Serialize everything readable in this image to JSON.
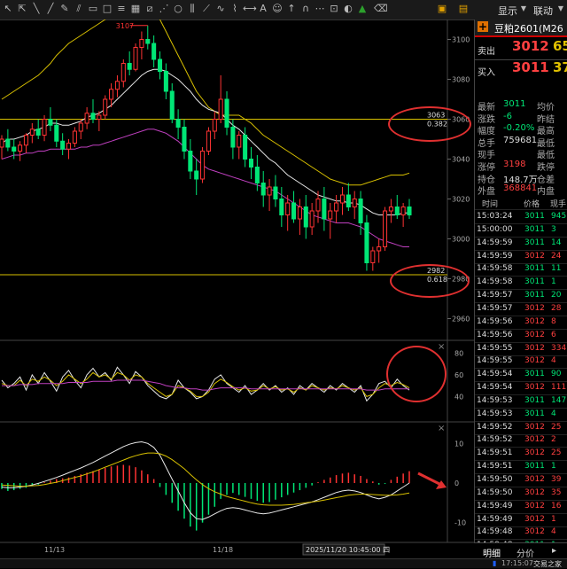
{
  "toolbar": {
    "display_label": "显示",
    "linkage_label": "联动"
  },
  "colors": {
    "up": "#ff3333",
    "down": "#00e676",
    "ma_yellow": "#d8c000",
    "ma_white": "#e8e8e8",
    "ma_purple": "#c040c0",
    "accent": "#e03030"
  },
  "quote": {
    "title": "豆粕2601(M26",
    "sell_label": "卖出",
    "sell_price": "3012",
    "sell_vol": "65",
    "buy_label": "买入",
    "buy_price": "3011",
    "buy_vol": "37",
    "stats": [
      {
        "label": "最新",
        "value": "3011",
        "label2": "均价",
        "value2": ""
      },
      {
        "label": "涨跌",
        "value": "-6",
        "label2": "昨结",
        "value2": ""
      },
      {
        "label": "幅度",
        "value": "-0.20%",
        "label2": "最高",
        "value2": ""
      },
      {
        "label": "总手",
        "value": "759681",
        "label2": "最低",
        "value2": ""
      },
      {
        "label": "现手",
        "value": "",
        "label2": "最低",
        "value2": ""
      },
      {
        "label": "涨停",
        "value": "3198",
        "label2": "跌停",
        "value2": ""
      },
      {
        "label": "持仓",
        "value": "148.7万",
        "label2": "仓差",
        "value2": ""
      },
      {
        "label": "外盘",
        "value": "368841",
        "label2": "内盘",
        "value2": ""
      }
    ],
    "ticks_header": {
      "time": "时间",
      "price": "价格",
      "vol": "现手"
    },
    "ticks": [
      {
        "time": "15:03:24",
        "price": "3011",
        "vol": "945",
        "dir": "down"
      },
      {
        "time": "15:00:00",
        "price": "3011",
        "vol": "3",
        "dir": "down"
      },
      {
        "time": "14:59:59",
        "price": "3011",
        "vol": "14",
        "dir": "down"
      },
      {
        "time": "14:59:59",
        "price": "3012",
        "vol": "24",
        "dir": "up"
      },
      {
        "time": "14:59:58",
        "price": "3011",
        "vol": "11",
        "dir": "down"
      },
      {
        "time": "14:59:58",
        "price": "3011",
        "vol": "1",
        "dir": "down"
      },
      {
        "time": "14:59:57",
        "price": "3011",
        "vol": "20",
        "dir": "down"
      },
      {
        "time": "14:59:57",
        "price": "3012",
        "vol": "28",
        "dir": "up"
      },
      {
        "time": "14:59:56",
        "price": "3012",
        "vol": "8",
        "dir": "up"
      },
      {
        "time": "14:59:56",
        "price": "3012",
        "vol": "6",
        "dir": "up"
      },
      {
        "time": "14:59:55",
        "price": "3012",
        "vol": "334",
        "dir": "up"
      },
      {
        "time": "14:59:55",
        "price": "3012",
        "vol": "4",
        "dir": "up"
      },
      {
        "time": "14:59:54",
        "price": "3011",
        "vol": "90",
        "dir": "down"
      },
      {
        "time": "14:59:54",
        "price": "3012",
        "vol": "111",
        "dir": "up"
      },
      {
        "time": "14:59:53",
        "price": "3011",
        "vol": "147",
        "dir": "down"
      },
      {
        "time": "14:59:53",
        "price": "3011",
        "vol": "4",
        "dir": "down"
      },
      {
        "time": "14:59:52",
        "price": "3012",
        "vol": "25",
        "dir": "up"
      },
      {
        "time": "14:59:52",
        "price": "3012",
        "vol": "2",
        "dir": "up"
      },
      {
        "time": "14:59:51",
        "price": "3012",
        "vol": "25",
        "dir": "up"
      },
      {
        "time": "14:59:51",
        "price": "3011",
        "vol": "1",
        "dir": "down"
      },
      {
        "time": "14:59:50",
        "price": "3012",
        "vol": "39",
        "dir": "up"
      },
      {
        "time": "14:59:50",
        "price": "3012",
        "vol": "35",
        "dir": "up"
      },
      {
        "time": "14:59:49",
        "price": "3012",
        "vol": "16",
        "dir": "up"
      },
      {
        "time": "14:59:49",
        "price": "3012",
        "vol": "1",
        "dir": "up"
      },
      {
        "time": "14:59:48",
        "price": "3012",
        "vol": "4",
        "dir": "up"
      },
      {
        "time": "14:59:48",
        "price": "3011",
        "vol": "1",
        "dir": "down"
      }
    ]
  },
  "bottom_tabs": {
    "detail": "明细",
    "price_split": "分价"
  },
  "statusbar": {
    "clock": "17:15:07",
    "brand": "交易之家"
  },
  "chart_data": {
    "type": "candlestick",
    "price_axis": {
      "ylim": [
        2950,
        3110
      ],
      "ticks": [
        "3100",
        "3080",
        "3060",
        "3040",
        "3020",
        "3000",
        "2980",
        "2960"
      ]
    },
    "high_marker": "3107",
    "fib_levels": [
      {
        "price": "3063",
        "ratio": "0.382",
        "y": 3060
      },
      {
        "price": "2982",
        "ratio": "0.618",
        "y": 2982
      }
    ],
    "x_labels": [
      "11/13",
      "11/18"
    ],
    "cursor_label": "2025/11/20 10:45:00 四",
    "candles": [
      [
        3046,
        3052,
        3040,
        3050
      ],
      [
        3050,
        3055,
        3044,
        3046
      ],
      [
        3046,
        3050,
        3040,
        3044
      ],
      [
        3044,
        3049,
        3039,
        3047
      ],
      [
        3047,
        3053,
        3043,
        3052
      ],
      [
        3052,
        3058,
        3048,
        3055
      ],
      [
        3055,
        3060,
        3050,
        3052
      ],
      [
        3052,
        3062,
        3049,
        3060
      ],
      [
        3060,
        3066,
        3054,
        3057
      ],
      [
        3057,
        3060,
        3046,
        3049
      ],
      [
        3049,
        3053,
        3042,
        3045
      ],
      [
        3045,
        3050,
        3040,
        3048
      ],
      [
        3048,
        3056,
        3046,
        3054
      ],
      [
        3054,
        3060,
        3050,
        3058
      ],
      [
        3058,
        3066,
        3055,
        3063
      ],
      [
        3063,
        3070,
        3058,
        3060
      ],
      [
        3060,
        3064,
        3054,
        3062
      ],
      [
        3062,
        3072,
        3060,
        3070
      ],
      [
        3070,
        3078,
        3066,
        3075
      ],
      [
        3075,
        3082,
        3071,
        3079
      ],
      [
        3079,
        3090,
        3076,
        3088
      ],
      [
        3088,
        3094,
        3082,
        3085
      ],
      [
        3085,
        3098,
        3084,
        3096
      ],
      [
        3096,
        3104,
        3090,
        3100
      ],
      [
        3100,
        3107,
        3095,
        3098
      ],
      [
        3098,
        3102,
        3086,
        3090
      ],
      [
        3090,
        3094,
        3080,
        3084
      ],
      [
        3084,
        3088,
        3070,
        3074
      ],
      [
        3074,
        3078,
        3058,
        3060
      ],
      [
        3060,
        3065,
        3050,
        3056
      ],
      [
        3056,
        3060,
        3040,
        3044
      ],
      [
        3044,
        3050,
        3030,
        3034
      ],
      [
        3034,
        3040,
        3022,
        3030
      ],
      [
        3030,
        3046,
        3028,
        3044
      ],
      [
        3044,
        3056,
        3042,
        3054
      ],
      [
        3054,
        3064,
        3050,
        3060
      ],
      [
        3060,
        3082,
        3058,
        3070
      ],
      [
        3070,
        3074,
        3052,
        3056
      ],
      [
        3056,
        3060,
        3040,
        3046
      ],
      [
        3046,
        3054,
        3040,
        3052
      ],
      [
        3052,
        3056,
        3036,
        3040
      ],
      [
        3040,
        3046,
        3030,
        3036
      ],
      [
        3036,
        3042,
        3024,
        3028
      ],
      [
        3028,
        3034,
        3016,
        3022
      ],
      [
        3022,
        3030,
        3014,
        3026
      ],
      [
        3026,
        3032,
        3016,
        3020
      ],
      [
        3020,
        3026,
        3006,
        3012
      ],
      [
        3012,
        3022,
        3004,
        3018
      ],
      [
        3018,
        3024,
        3008,
        3010
      ],
      [
        3010,
        3020,
        3002,
        3016
      ],
      [
        3016,
        3022,
        3000,
        3006
      ],
      [
        3006,
        3018,
        3002,
        3014
      ],
      [
        3014,
        3024,
        3008,
        3020
      ],
      [
        3020,
        3026,
        3004,
        3010
      ],
      [
        3010,
        3018,
        3000,
        3014
      ],
      [
        3014,
        3022,
        3008,
        3018
      ],
      [
        3018,
        3026,
        3012,
        3022
      ],
      [
        3022,
        3028,
        3014,
        3016
      ],
      [
        3016,
        3024,
        3010,
        3020
      ],
      [
        3020,
        3024,
        3002,
        3008
      ],
      [
        3008,
        3012,
        2984,
        2988
      ],
      [
        2988,
        2996,
        2984,
        2994
      ],
      [
        2994,
        3000,
        2988,
        2996
      ],
      [
        2996,
        3016,
        2994,
        3014
      ],
      [
        3014,
        3020,
        3008,
        3016
      ],
      [
        3016,
        3022,
        3010,
        3012
      ],
      [
        3012,
        3018,
        3006,
        3016
      ],
      [
        3016,
        3020,
        3010,
        3012
      ]
    ],
    "ma_white": [
      3048,
      3050,
      3050,
      3051,
      3052,
      3054,
      3055,
      3056,
      3058,
      3058,
      3057,
      3057,
      3058,
      3059,
      3061,
      3062,
      3063,
      3065,
      3067,
      3070,
      3073,
      3076,
      3079,
      3082,
      3084,
      3085,
      3085,
      3084,
      3082,
      3080,
      3077,
      3074,
      3070,
      3067,
      3065,
      3064,
      3063,
      3060,
      3057,
      3055,
      3052,
      3049,
      3046,
      3043,
      3040,
      3038,
      3035,
      3032,
      3030,
      3028,
      3026,
      3024,
      3022,
      3021,
      3020,
      3019,
      3019,
      3018,
      3018,
      3017,
      3015,
      3013,
      3012,
      3012,
      3012,
      3012,
      3013,
      3013
    ],
    "ma_purple": [
      3040,
      3041,
      3042,
      3042,
      3043,
      3043,
      3044,
      3044,
      3045,
      3045,
      3045,
      3045,
      3045,
      3046,
      3046,
      3047,
      3047,
      3048,
      3049,
      3050,
      3051,
      3052,
      3053,
      3054,
      3055,
      3055,
      3054,
      3053,
      3051,
      3049,
      3046,
      3043,
      3040,
      3037,
      3035,
      3034,
      3033,
      3032,
      3031,
      3030,
      3029,
      3028,
      3027,
      3026,
      3025,
      3024,
      3022,
      3020,
      3018,
      3016,
      3014,
      3012,
      3011,
      3010,
      3009,
      3008,
      3008,
      3008,
      3007,
      3006,
      3004,
      3002,
      3000,
      2999,
      2998,
      2997,
      2996,
      2996
    ],
    "boll_upper": [
      3070,
      3072,
      3074,
      3076,
      3078,
      3080,
      3082,
      3085,
      3088,
      3092,
      3095,
      3098,
      3100,
      3102,
      3104,
      3106,
      3108,
      3110,
      3112,
      3114,
      3116,
      3118,
      3120,
      3120,
      3118,
      3115,
      3110,
      3104,
      3098,
      3092,
      3086,
      3080,
      3074,
      3070,
      3066,
      3064,
      3062,
      3062,
      3062,
      3062,
      3060,
      3058,
      3055,
      3052,
      3050,
      3048,
      3046,
      3044,
      3042,
      3040,
      3038,
      3036,
      3034,
      3032,
      3030,
      3029,
      3028,
      3027,
      3027,
      3027,
      3028,
      3029,
      3030,
      3031,
      3032,
      3032,
      3032,
      3033
    ],
    "rsi": {
      "ticks": [
        "80",
        "60",
        "40"
      ],
      "ylim": [
        20,
        90
      ],
      "white": [
        55,
        48,
        52,
        58,
        46,
        60,
        52,
        62,
        54,
        45,
        58,
        64,
        55,
        48,
        60,
        66,
        58,
        62,
        55,
        67,
        60,
        52,
        63,
        58,
        50,
        45,
        40,
        38,
        42,
        55,
        48,
        44,
        38,
        40,
        46,
        56,
        60,
        52,
        48,
        44,
        50,
        42,
        46,
        52,
        46,
        50,
        44,
        48,
        42,
        50,
        46,
        52,
        48,
        44,
        50,
        46,
        52,
        48,
        44,
        50,
        36,
        42,
        52,
        54,
        48,
        56,
        50,
        46
      ],
      "yellow": [
        52,
        50,
        50,
        55,
        50,
        56,
        54,
        58,
        55,
        50,
        54,
        60,
        56,
        52,
        56,
        62,
        58,
        60,
        56,
        62,
        60,
        55,
        60,
        58,
        52,
        48,
        44,
        40,
        42,
        50,
        48,
        45,
        40,
        40,
        44,
        52,
        56,
        53,
        49,
        46,
        48,
        45,
        46,
        50,
        47,
        49,
        46,
        47,
        44,
        48,
        46,
        50,
        48,
        46,
        48,
        47,
        50,
        48,
        46,
        48,
        40,
        42,
        48,
        52,
        50,
        53,
        51,
        48
      ],
      "purple": [
        50,
        50,
        50,
        51,
        51,
        51,
        52,
        52,
        52,
        52,
        52,
        53,
        53,
        53,
        53,
        54,
        54,
        54,
        54,
        55,
        55,
        55,
        55,
        55,
        54,
        53,
        52,
        50,
        49,
        48,
        48,
        47,
        47,
        46,
        46,
        47,
        48,
        48,
        48,
        48,
        48,
        47,
        47,
        47,
        47,
        47,
        47,
        47,
        47,
        47,
        47,
        47,
        47,
        47,
        47,
        47,
        47,
        47,
        47,
        47,
        46,
        46,
        46,
        47,
        47,
        47,
        47,
        47
      ]
    },
    "macd": {
      "ticks": [
        "10",
        "0",
        "-10"
      ],
      "ylim": [
        -15,
        15
      ],
      "hist": [
        -1.5,
        -2,
        -1.8,
        -1.5,
        -1.2,
        -0.8,
        -0.4,
        0.2,
        0.6,
        1,
        1.2,
        1.4,
        1.8,
        2.2,
        2.6,
        3,
        3.4,
        3.8,
        4.2,
        4.4,
        4.6,
        4.4,
        4,
        3.2,
        2.2,
        1,
        -1,
        -3,
        -5,
        -7,
        -9,
        -11,
        -12,
        -10,
        -8,
        -6,
        -4,
        -3,
        -2.5,
        -3,
        -3.5,
        -4,
        -4.5,
        -5,
        -4.8,
        -4.2,
        -3.6,
        -3,
        -2.4,
        -1.8,
        -1.2,
        -0.6,
        0.2,
        0.8,
        1.4,
        2,
        2.4,
        2.6,
        2.2,
        1.8,
        1,
        0.4,
        -0.4,
        -0.2,
        0.8,
        1.6,
        2.4,
        3
      ],
      "dif": [
        -1,
        -1.2,
        -1.2,
        -1,
        -0.8,
        -0.5,
        -0.1,
        0.4,
        0.9,
        1.4,
        2,
        2.6,
        3.2,
        3.8,
        4.5,
        5.2,
        6,
        6.8,
        7.6,
        8.4,
        9.2,
        9.8,
        10.2,
        10.4,
        10,
        9,
        7,
        4,
        1,
        -2,
        -5,
        -7.5,
        -9,
        -9.2,
        -8.6,
        -7.8,
        -7,
        -6.4,
        -6.2,
        -6.4,
        -6.8,
        -7.2,
        -7.6,
        -7.8,
        -7.6,
        -7.2,
        -6.8,
        -6.4,
        -6,
        -5.6,
        -5.2,
        -4.8,
        -4.2,
        -3.6,
        -3,
        -2.4,
        -2,
        -1.8,
        -2,
        -2.4,
        -3,
        -3.6,
        -4,
        -3.6,
        -3,
        -2,
        -1,
        0
      ],
      "dea": [
        -0.5,
        -0.6,
        -0.7,
        -0.8,
        -0.8,
        -0.7,
        -0.6,
        -0.4,
        -0.1,
        0.2,
        0.6,
        1,
        1.4,
        1.8,
        2.3,
        2.8,
        3.4,
        4,
        4.6,
        5.2,
        5.8,
        6.4,
        6.9,
        7.3,
        7.6,
        7.6,
        7.4,
        6.8,
        5.9,
        4.8,
        3.6,
        2.2,
        0.8,
        -0.4,
        -1.4,
        -2.2,
        -2.8,
        -3.4,
        -3.8,
        -4.2,
        -4.6,
        -5,
        -5.3,
        -5.5,
        -5.6,
        -5.6,
        -5.6,
        -5.5,
        -5.4,
        -5.2,
        -5,
        -4.8,
        -4.6,
        -4.3,
        -4,
        -3.7,
        -3.4,
        -3.1,
        -2.9,
        -2.8,
        -2.8,
        -2.9,
        -3,
        -3.1,
        -3.1,
        -3,
        -2.8,
        -2.5
      ]
    }
  }
}
